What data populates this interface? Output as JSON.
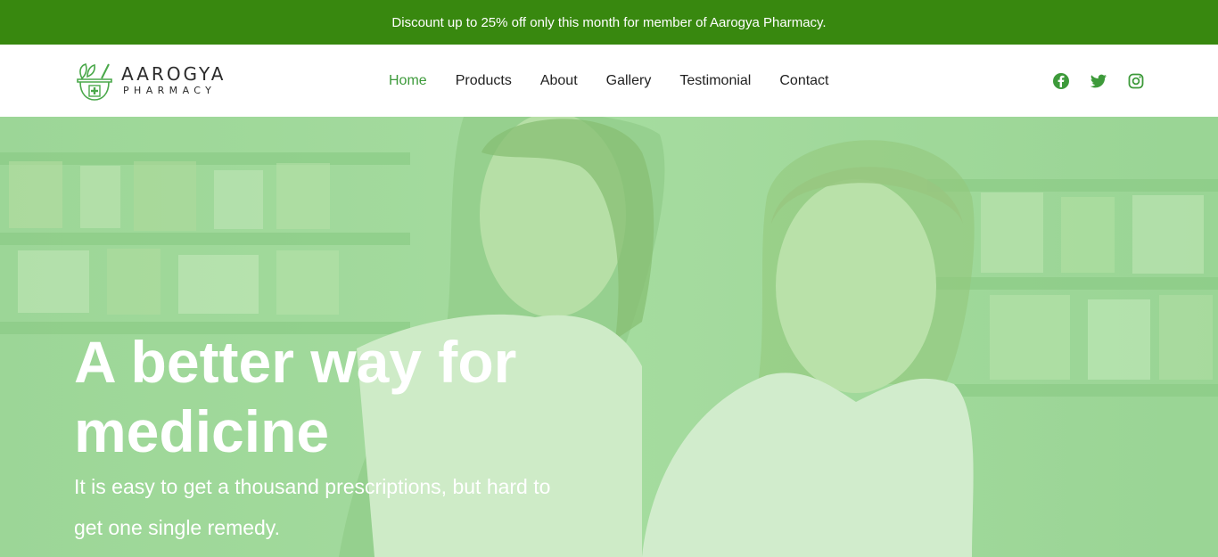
{
  "promo": {
    "text": "Discount up to 25% off only this month for member of Aarogya Pharmacy."
  },
  "brand": {
    "name": "AAROGYA",
    "tagline": "PHARMACY"
  },
  "nav": {
    "items": [
      {
        "label": "Home",
        "active": true
      },
      {
        "label": "Products",
        "active": false
      },
      {
        "label": "About",
        "active": false
      },
      {
        "label": "Gallery",
        "active": false
      },
      {
        "label": "Testimonial",
        "active": false
      },
      {
        "label": "Contact",
        "active": false
      }
    ]
  },
  "social": {
    "icons": [
      "facebook-icon",
      "twitter-icon",
      "instagram-icon"
    ]
  },
  "hero": {
    "title": "A better way for medicine",
    "subtitle": "It is easy to get a thousand prescriptions, but hard to get one single remedy."
  },
  "colors": {
    "brand_green": "#38880f",
    "accent_green": "#3d9a3a",
    "hero_tint": "#9fd69b"
  }
}
